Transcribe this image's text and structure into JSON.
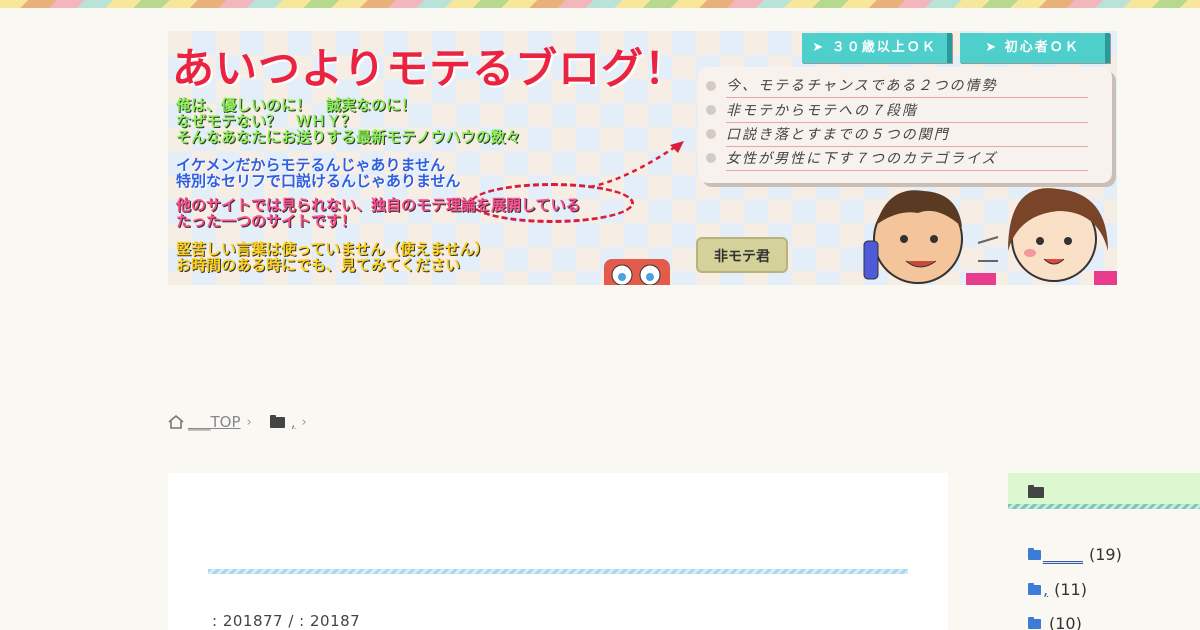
{
  "header": {
    "title": "あいつよりモテるブログ！",
    "buttons": [
      "➤ ３０歳以上ＯＫ",
      "➤ 初心者ＯＫ"
    ],
    "green_lines": [
      "俺は、優しいのに！　誠実なのに！",
      "なぜモテない？　ＷＨＹ？",
      "そんなあなたにお送りする最新モテノウハウの数々"
    ],
    "blue_lines": [
      "イケメンだからモテるんじゃありません",
      "特別なセリフで口説けるんじゃありません"
    ],
    "pink_lines": [
      "他のサイトでは見られない、独自のモテ理論を展開している",
      "たった一つのサイトです！"
    ],
    "yellow_lines": [
      "堅苦しい言葉は使っていません（使えません）",
      "お時間のある時にでも、見てみてください"
    ],
    "notes": [
      "今、モテるチャンスである２つの情勢",
      "非モテからモテへの７段階",
      "口説き落とすまでの５つの関門",
      "女性が男性に下す７つのカテゴライズ"
    ],
    "tag": "非モテ君"
  },
  "breadcrumb": {
    "home_label": "___TOP",
    "category_label": ","
  },
  "post": {
    "meta": ":  201877 / :  20187"
  },
  "sidebar": {
    "items": [
      {
        "label": "_____",
        "count": "(19)"
      },
      {
        "label": ",",
        "count": "(11)"
      },
      {
        "label": "",
        "count": "(10)"
      }
    ]
  },
  "colors": {
    "accent_red": "#ea2340",
    "teal_button": "#4fcfcc",
    "sidebar_head": "#dbf8d0",
    "folder_blue": "#3d7bd6"
  }
}
